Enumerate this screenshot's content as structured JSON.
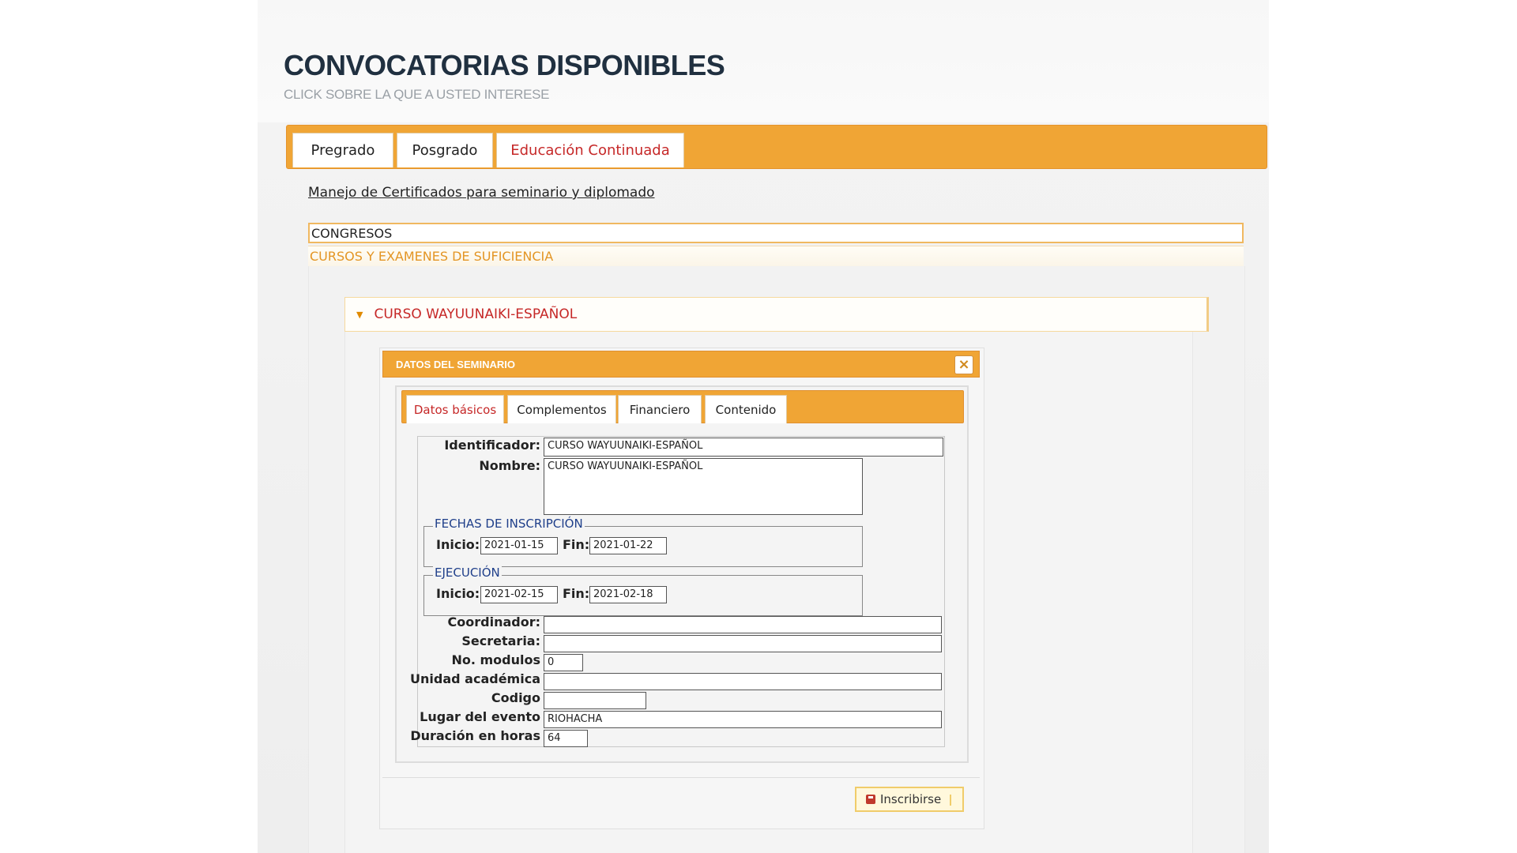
{
  "header": {
    "title": "CONVOCATORIAS DISPONIBLES",
    "subtitle": "CLICK SOBRE LA QUE A USTED INTERESE"
  },
  "main_tabs": [
    {
      "label": "Pregrado",
      "active": false
    },
    {
      "label": "Posgrado",
      "active": false
    },
    {
      "label": "Educación Continuada",
      "active": true
    }
  ],
  "certificates_link": "Manejo de Certificados para seminario y diplomado",
  "sections": {
    "congresos": "CONGRESOS",
    "cursos": "CURSOS Y EXAMENES DE SUFICIENCIA"
  },
  "course": {
    "title": "CURSO WAYUUNAIKI-ESPAÑOL"
  },
  "dialog": {
    "title": "DATOS DEL SEMINARIO",
    "close_icon": "close-icon",
    "tabs": [
      {
        "label": "Datos básicos",
        "active": true
      },
      {
        "label": "Complementos",
        "active": false
      },
      {
        "label": "Financiero",
        "active": false
      },
      {
        "label": "Contenido",
        "active": false
      }
    ],
    "form": {
      "identificador_label": "Identificador:",
      "identificador": "CURSO WAYUUNAIKI-ESPAÑOL",
      "nombre_label": "Nombre:",
      "nombre": "CURSO WAYUUNAIKI-ESPAÑOL",
      "inscripcion": {
        "legend": "FECHAS DE INSCRIPCIÓN",
        "inicio_label": "Inicio:",
        "inicio": "2021-01-15",
        "fin_label": "Fin:",
        "fin": "2021-01-22"
      },
      "ejecucion": {
        "legend": "EJECUCIÓN",
        "inicio_label": "Inicio:",
        "inicio": "2021-02-15",
        "fin_label": "Fin:",
        "fin": "2021-02-18"
      },
      "coordinador_label": "Coordinador:",
      "coordinador": "",
      "secretaria_label": "Secretaria:",
      "secretaria": "",
      "modulos_label": "No. modulos",
      "modulos": "0",
      "unidad_label": "Unidad académica",
      "unidad": "",
      "codigo_label": "Codigo",
      "codigo": "",
      "lugar_label": "Lugar del evento",
      "lugar": "RIOHACHA",
      "duracion_label": "Duración en horas",
      "duracion": "64"
    },
    "inscribirse_button": "Inscribirse",
    "colors": {
      "accent": "#f0a535",
      "active_tab_text": "#c62828",
      "legend": "#1f3f8a"
    }
  }
}
